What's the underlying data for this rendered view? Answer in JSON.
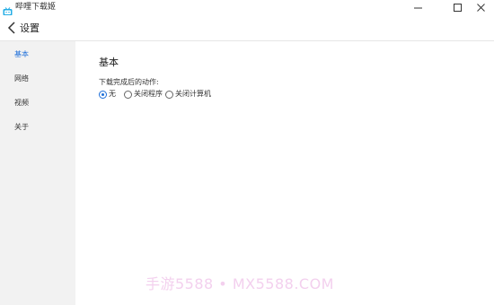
{
  "window": {
    "title": "哔哩下载姬"
  },
  "header": {
    "title": "设置"
  },
  "sidebar": {
    "items": [
      {
        "label": "基本",
        "active": true
      },
      {
        "label": "网络",
        "active": false
      },
      {
        "label": "视频",
        "active": false
      },
      {
        "label": "关于",
        "active": false
      }
    ]
  },
  "main": {
    "section_title": "基本",
    "after_download_label": "下载完成后的动作:",
    "options": [
      {
        "label": "无",
        "checked": true
      },
      {
        "label": "关闭程序",
        "checked": false
      },
      {
        "label": "关闭计算机",
        "checked": false
      }
    ]
  },
  "watermark": "手游5588 • MX5588.COM",
  "colors": {
    "accent": "#1e6fd9",
    "sidebar_bg": "#f2f2f2"
  }
}
